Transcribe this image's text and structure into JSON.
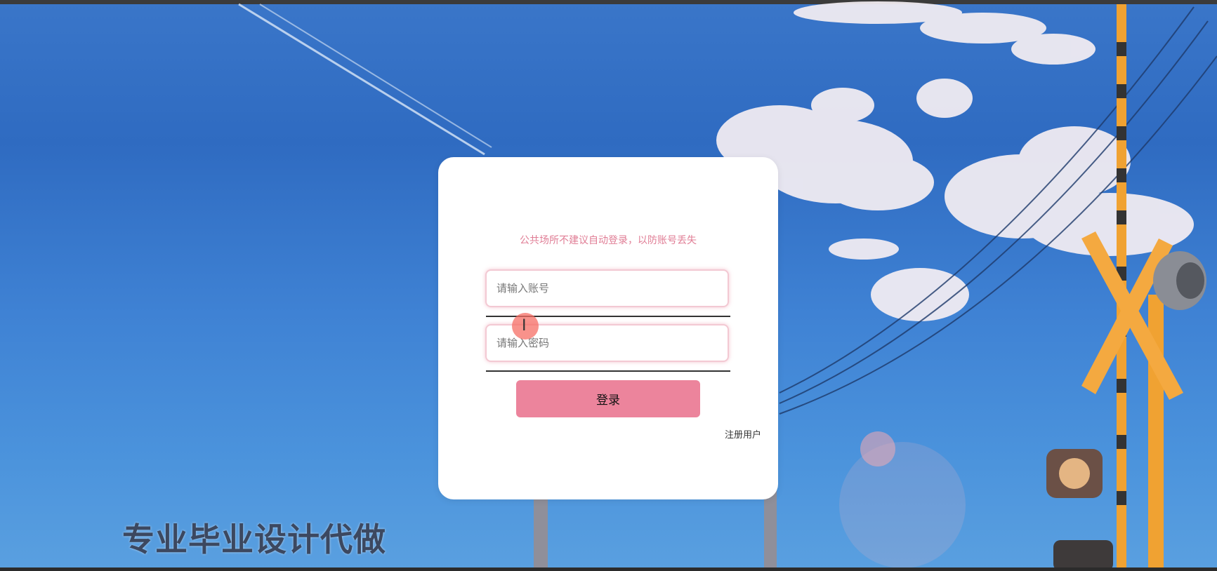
{
  "login": {
    "notice": "公共场所不建议自动登录，以防账号丢失",
    "username_placeholder": "请输入账号",
    "password_placeholder": "请输入密码",
    "login_label": "登录",
    "register_label": "注册用户"
  },
  "watermark": "专业毕业设计代做",
  "cursor": {
    "icon": "text-cursor-icon",
    "glyph": "I"
  },
  "colors": {
    "accent": "#ec849c",
    "notice": "#e07d95",
    "sky": "#3a76c9"
  }
}
